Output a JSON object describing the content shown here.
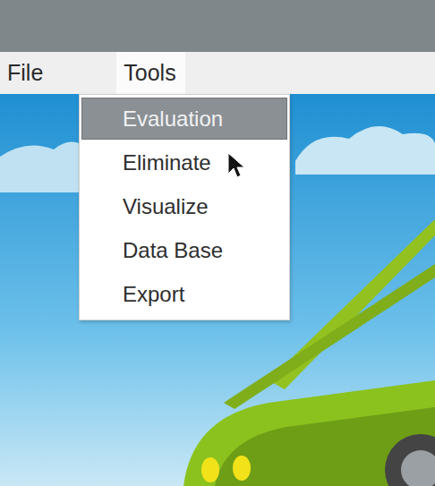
{
  "menu_bar": [
    {
      "label": "File",
      "selected": false
    },
    {
      "label": "Tools",
      "selected": true
    }
  ],
  "menu": {
    "items": [
      {
        "label": "Evaluation",
        "selected": true
      },
      {
        "label": "Eliminate",
        "selected": false
      },
      {
        "label": "Visualize",
        "selected": false
      },
      {
        "label": "Data Base",
        "selected": false
      },
      {
        "label": "Export",
        "selected": false
      }
    ]
  }
}
